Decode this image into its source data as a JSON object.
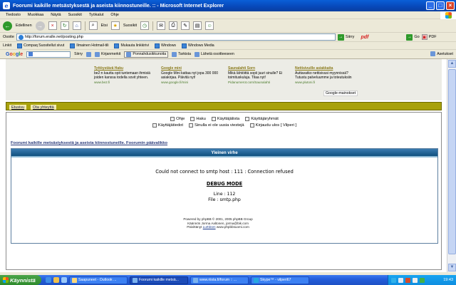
{
  "window": {
    "title": "Foorumi kaikille metsästyksestä ja aseista kiinnostuneille. :: - Microsoft Internet Explorer"
  },
  "menu": [
    "Tiedosto",
    "Muokkaa",
    "Näytä",
    "Suosikit",
    "Työkalut",
    "Ohje"
  ],
  "toolbar": {
    "back_label": "Edellinen",
    "search_label": "Etsi",
    "favorites_label": "Suosikit"
  },
  "address": {
    "label": "Osoite",
    "url": "http://forum.eralle.net/posting.php",
    "go_label": "Siirry",
    "pdf_label": "pdf",
    "go2_label": "Go",
    "pdf2_label": "PDF"
  },
  "links": {
    "label": "Linkit",
    "items": [
      "Compaq Suositellut sivut",
      "Ilmainen Hotmail-tili",
      "Mukauta linkkirivi",
      "Windows",
      "Windows Media"
    ]
  },
  "googlebar": {
    "logo": "Google",
    "go_label": "Siirry",
    "bookmarks_label": "Kirjanmerkit",
    "blocked_label": "Ponnahdusikkunoita",
    "spell_label": "Tarkista",
    "send_label": "Lähetä osoitteeseen",
    "settings_label": "Asetukset"
  },
  "ads": [
    {
      "title": "Tyttöystävä Haku",
      "body": "be2:n kautta opit tuntemaan ihmisiä joiden kanssa todella sovit yhteen.",
      "url": "www.be2.fi"
    },
    {
      "title": "Google mini",
      "body": "Google Mini kattaa nyt jopa 300 000 asiakirjaa. Päivitä nyt!",
      "url": "www.google.fi/mini"
    },
    {
      "title": "Saunalahti Sorn",
      "body": "Mikä lähtöittä sopii juuri sinulle? Ei toimituskuluja. Tilaa nyt!",
      "url": "Pidanumerot.com/Saunalahti"
    },
    {
      "title": "Nettisivuille asiakkaita",
      "body": "Auttavatko nettisivusi myynnissä? Tutustu palveluumme ja toteutuksiin",
      "url": "www.plutoni.fi"
    }
  ],
  "google_ads_label": "Google-mainokset",
  "nav": [
    "Etusivu",
    "Ota yhteyttä"
  ],
  "forum_links": {
    "row1": [
      "Ohje",
      "Haku",
      "Käyttäjälista",
      "Käyttäjäryhmät"
    ],
    "row2": [
      "Käyttäjätiedot",
      "Sinulla ei ole uusia viestejä",
      "Kirjaudu ulos [ Vilperi ]"
    ]
  },
  "forum_title": "Foorumi kaikille metsästyksestä ja aseista kiinnostuneille. Foorumin päävalikko",
  "error": {
    "header": "Yleinen virhe",
    "message": "Could not connect to smtp host : 111 : Connection refused",
    "debug_title": "DEBUG MODE",
    "line": "Line : 112",
    "file": "File : smtp.php"
  },
  "footer": {
    "line1": "Powered by phpBB © 2001, 2005 phpBB Group",
    "line2": "Käännös Jorma Aaltonen, jorma@bik.com",
    "line3_prefix": "Päivittänyt ",
    "line3_link": "Lurttinen",
    "line3_suffix": " www.phpbbsuomi.com"
  },
  "taskbar": {
    "start_label": "Käynnistä",
    "tasks": [
      "Saapuneet - Outlook ...",
      "Foorumi kaikille metsä...",
      "www.riista.fi/forum :: ...",
      "Skype™ - vilperi67"
    ],
    "active_index": 1,
    "clock": "19:43"
  }
}
